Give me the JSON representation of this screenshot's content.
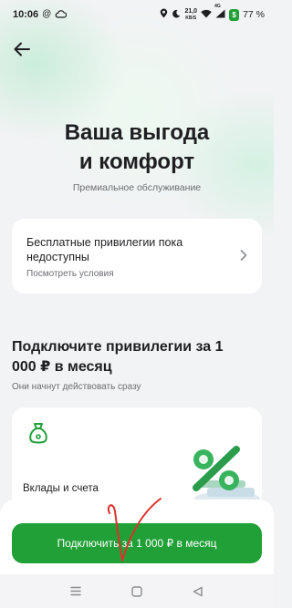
{
  "status_bar": {
    "time": "10:06",
    "left_icons": [
      "at-icon",
      "cloud-icon"
    ],
    "net_speed_value": "21,0",
    "net_speed_unit": "KB/S",
    "network_type": "4G",
    "battery_percent": "77 %"
  },
  "header": {
    "back_icon": "arrow-left-icon"
  },
  "hero": {
    "title_line1": "Ваша выгода",
    "title_line2": "и комфорт",
    "subtitle": "Премиальное обслуживание"
  },
  "privileges_card": {
    "title": "Бесплатные привилегии пока недоступны",
    "subtitle": "Посмотреть условия",
    "icon": "chevron-right-icon"
  },
  "connect_section": {
    "title": "Подключите привилегии за 1 000 ₽ в месяц",
    "subtitle": "Они начнут действовать сразу"
  },
  "deposit_card": {
    "icon": "money-bag-icon",
    "label": "Вклады и счета"
  },
  "cta": {
    "label": "Подключить за 1 000 ₽ в месяц"
  },
  "nav_bar": {
    "icons": [
      "recent-apps-icon",
      "home-icon",
      "back-icon"
    ]
  },
  "colors": {
    "accent": "#21a038",
    "background": "#f2f3f4",
    "card": "#ffffff",
    "scribble": "#d9332e"
  }
}
